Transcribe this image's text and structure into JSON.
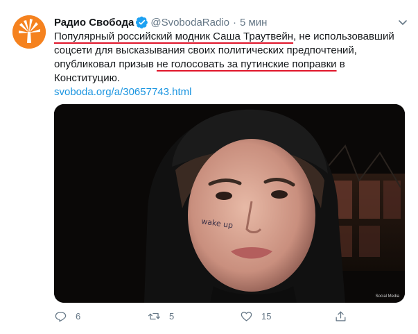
{
  "tweet": {
    "author_name": "Радио Свобода",
    "handle": "@SvobodaRadio",
    "separator": "·",
    "time": "5 мин",
    "text_part1": "Популярный российский модник Саша Траутвейн",
    "text_part2": ", не использовавший соцсети для высказывания своих политических предпочтений, опубликовал призыв ",
    "text_part3": "не голосовать за путинские поправки",
    "text_part4": " в Конституцию.",
    "link": "svoboda.org/a/30657743.html",
    "media": {
      "tattoo_text": "wake up",
      "watermark": "Social Media"
    },
    "actions": {
      "reply_count": "6",
      "retweet_count": "5",
      "like_count": "15"
    }
  },
  "colors": {
    "accent": "#1b95e0",
    "underline": "#e0152a",
    "avatar_bg": "#f5821f",
    "muted": "#657786"
  },
  "icons": [
    "avatar-logo-icon",
    "verified-icon",
    "chevron-down-icon",
    "reply-icon",
    "retweet-icon",
    "like-icon",
    "share-icon"
  ]
}
